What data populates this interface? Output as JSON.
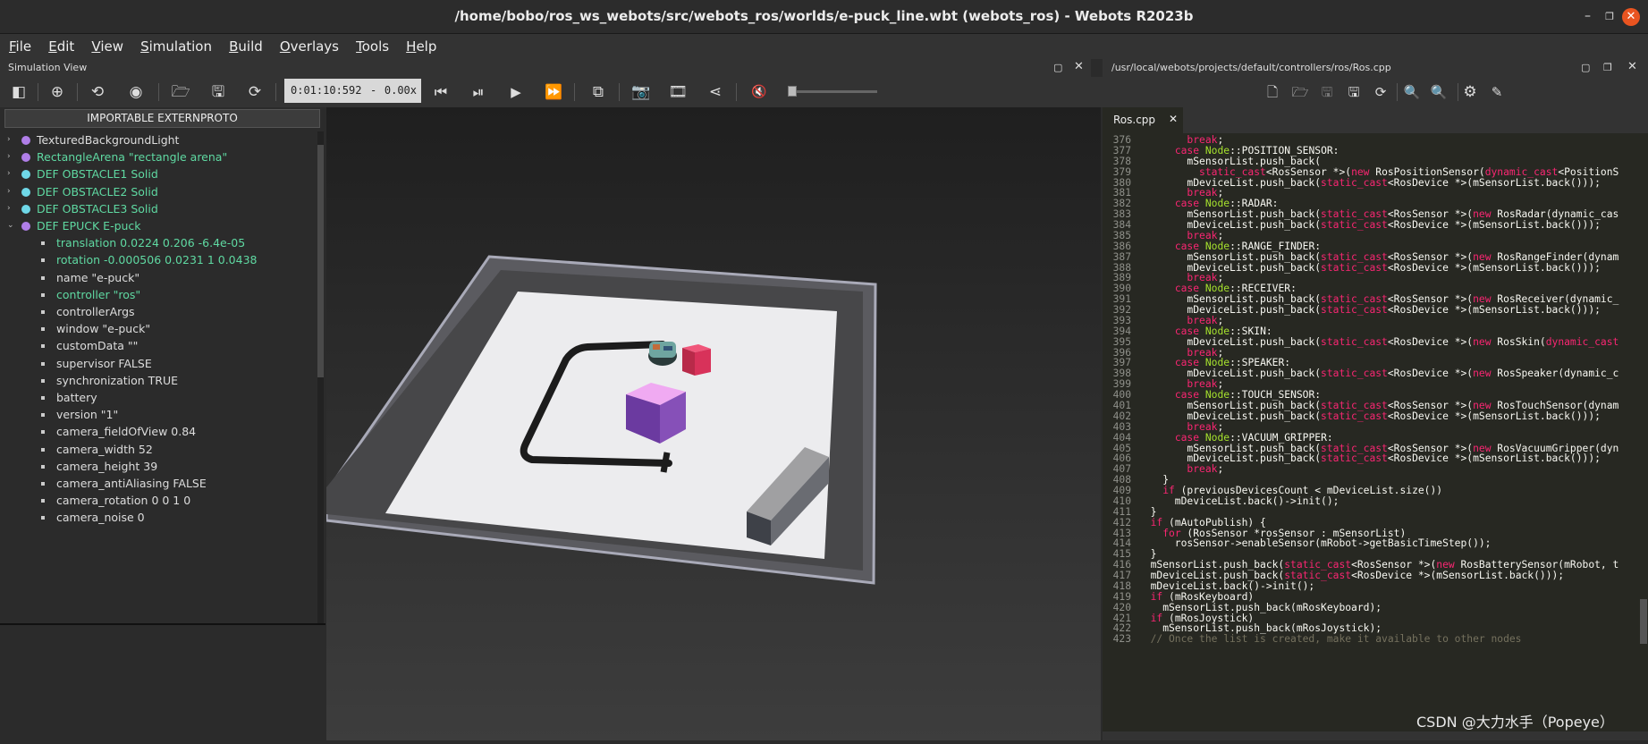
{
  "window": {
    "title": "/home/bobo/ros_ws_webots/src/webots_ros/worlds/e-puck_line.wbt (webots_ros) - Webots R2023b",
    "minimize": "–",
    "maximize": "❐",
    "close": "✕"
  },
  "menu": [
    {
      "key": "F",
      "rest": "ile"
    },
    {
      "key": "E",
      "rest": "dit"
    },
    {
      "key": "V",
      "rest": "iew"
    },
    {
      "key": "S",
      "rest": "imulation"
    },
    {
      "key": "B",
      "rest": "uild"
    },
    {
      "key": "O",
      "rest": "verlays"
    },
    {
      "key": "T",
      "rest": "ools"
    },
    {
      "key": "H",
      "rest": "elp"
    }
  ],
  "sim_panel": {
    "title": "Simulation View"
  },
  "editor_panel": {
    "title": "/usr/local/webots/projects/default/controllers/ros/Ros.cpp"
  },
  "toolbar": {
    "time": "0:01:10:592",
    "dash": "-",
    "speed": "0.00x"
  },
  "import_button": "IMPORTABLE EXTERNPROTO",
  "scene_tree": [
    {
      "label": "TexturedBackgroundLight",
      "dot": "#b07ee8",
      "arrow": "›",
      "green": false
    },
    {
      "label": "RectangleArena \"rectangle arena\"",
      "dot": "#b07ee8",
      "arrow": "›",
      "green": true
    },
    {
      "label": "DEF OBSTACLE1 Solid",
      "dot": "#6fd8e8",
      "arrow": "›",
      "green": true
    },
    {
      "label": "DEF OBSTACLE2 Solid",
      "dot": "#6fd8e8",
      "arrow": "›",
      "green": true
    },
    {
      "label": "DEF OBSTACLE3 Solid",
      "dot": "#6fd8e8",
      "arrow": "›",
      "green": true
    },
    {
      "label": "DEF EPUCK E-puck",
      "dot": "#b07ee8",
      "arrow": "⌄",
      "green": true
    },
    {
      "label": "translation 0.0224 0.206 -6.4e-05",
      "field": true,
      "green": true
    },
    {
      "label": "rotation -0.000506 0.0231 1 0.0438",
      "field": true,
      "green": true
    },
    {
      "label": "name \"e-puck\"",
      "field": true,
      "green": false
    },
    {
      "label": "controller \"ros\"",
      "field": true,
      "green": true
    },
    {
      "label": "controllerArgs",
      "field": true,
      "green": false
    },
    {
      "label": "window \"e-puck\"",
      "field": true,
      "green": false
    },
    {
      "label": "customData \"\"",
      "field": true,
      "green": false
    },
    {
      "label": "supervisor FALSE",
      "field": true,
      "green": false
    },
    {
      "label": "synchronization TRUE",
      "field": true,
      "green": false
    },
    {
      "label": "battery",
      "field": true,
      "green": false
    },
    {
      "label": "version \"1\"",
      "field": true,
      "green": false
    },
    {
      "label": "camera_fieldOfView 0.84",
      "field": true,
      "green": false
    },
    {
      "label": "camera_width 52",
      "field": true,
      "green": false
    },
    {
      "label": "camera_height 39",
      "field": true,
      "green": false
    },
    {
      "label": "camera_antiAliasing FALSE",
      "field": true,
      "green": false
    },
    {
      "label": "camera_rotation 0 0 1 0",
      "field": true,
      "green": false
    },
    {
      "label": "camera_noise 0",
      "field": true,
      "green": false
    }
  ],
  "editor": {
    "tab_name": "Ros.cpp",
    "tab_close": "✕",
    "lines": [
      {
        "n": "376",
        "code": "        break;"
      },
      {
        "n": "377",
        "code": "      case Node::POSITION_SENSOR:"
      },
      {
        "n": "378",
        "code": "        mSensorList.push_back("
      },
      {
        "n": "379",
        "code": "          static_cast<RosSensor *>(new RosPositionSensor(dynamic_cast<PositionS"
      },
      {
        "n": "380",
        "code": "        mDeviceList.push_back(static_cast<RosDevice *>(mSensorList.back()));"
      },
      {
        "n": "381",
        "code": "        break;"
      },
      {
        "n": "382",
        "code": "      case Node::RADAR:"
      },
      {
        "n": "383",
        "code": "        mSensorList.push_back(static_cast<RosSensor *>(new RosRadar(dynamic_cas"
      },
      {
        "n": "384",
        "code": "        mDeviceList.push_back(static_cast<RosDevice *>(mSensorList.back()));"
      },
      {
        "n": "385",
        "code": "        break;"
      },
      {
        "n": "386",
        "code": "      case Node::RANGE_FINDER:"
      },
      {
        "n": "387",
        "code": "        mSensorList.push_back(static_cast<RosSensor *>(new RosRangeFinder(dynam"
      },
      {
        "n": "388",
        "code": "        mDeviceList.push_back(static_cast<RosDevice *>(mSensorList.back()));"
      },
      {
        "n": "389",
        "code": "        break;"
      },
      {
        "n": "390",
        "code": "      case Node::RECEIVER:"
      },
      {
        "n": "391",
        "code": "        mSensorList.push_back(static_cast<RosSensor *>(new RosReceiver(dynamic_"
      },
      {
        "n": "392",
        "code": "        mDeviceList.push_back(static_cast<RosDevice *>(mSensorList.back()));"
      },
      {
        "n": "393",
        "code": "        break;"
      },
      {
        "n": "394",
        "code": "      case Node::SKIN:"
      },
      {
        "n": "395",
        "code": "        mDeviceList.push_back(static_cast<RosDevice *>(new RosSkin(dynamic_cast"
      },
      {
        "n": "396",
        "code": "        break;"
      },
      {
        "n": "397",
        "code": "      case Node::SPEAKER:"
      },
      {
        "n": "398",
        "code": "        mDeviceList.push_back(static_cast<RosDevice *>(new RosSpeaker(dynamic_c"
      },
      {
        "n": "399",
        "code": "        break;"
      },
      {
        "n": "400",
        "code": "      case Node::TOUCH_SENSOR:"
      },
      {
        "n": "401",
        "code": "        mSensorList.push_back(static_cast<RosSensor *>(new RosTouchSensor(dynam"
      },
      {
        "n": "402",
        "code": "        mDeviceList.push_back(static_cast<RosDevice *>(mSensorList.back()));"
      },
      {
        "n": "403",
        "code": "        break;"
      },
      {
        "n": "404",
        "code": "      case Node::VACUUM_GRIPPER:"
      },
      {
        "n": "405",
        "code": "        mSensorList.push_back(static_cast<RosSensor *>(new RosVacuumGripper(dyn"
      },
      {
        "n": "406",
        "code": "        mDeviceList.push_back(static_cast<RosDevice *>(mSensorList.back()));"
      },
      {
        "n": "407",
        "code": "        break;"
      },
      {
        "n": "408",
        "code": "    }"
      },
      {
        "n": "409",
        "code": "    if (previousDevicesCount < mDeviceList.size())"
      },
      {
        "n": "410",
        "code": "      mDeviceList.back()->init();"
      },
      {
        "n": "411",
        "code": "  }"
      },
      {
        "n": "412",
        "code": "  if (mAutoPublish) {"
      },
      {
        "n": "413",
        "code": "    for (RosSensor *rosSensor : mSensorList)"
      },
      {
        "n": "414",
        "code": "      rosSensor->enableSensor(mRobot->getBasicTimeStep());"
      },
      {
        "n": "415",
        "code": "  }"
      },
      {
        "n": "416",
        "code": "  mSensorList.push_back(static_cast<RosSensor *>(new RosBatterySensor(mRobot, t"
      },
      {
        "n": "417",
        "code": "  mDeviceList.push_back(static_cast<RosDevice *>(mSensorList.back()));"
      },
      {
        "n": "418",
        "code": "  mDeviceList.back()->init();"
      },
      {
        "n": "419",
        "code": "  if (mRosKeyboard)"
      },
      {
        "n": "420",
        "code": "    mSensorList.push_back(mRosKeyboard);"
      },
      {
        "n": "421",
        "code": "  if (mRosJoystick)"
      },
      {
        "n": "422",
        "code": "    mSensorList.push_back(mRosJoystick);"
      },
      {
        "n": "423",
        "code": "  // Once the list is created, make it available to other nodes"
      }
    ]
  },
  "watermark": "CSDN @大力水手（Popeye）"
}
